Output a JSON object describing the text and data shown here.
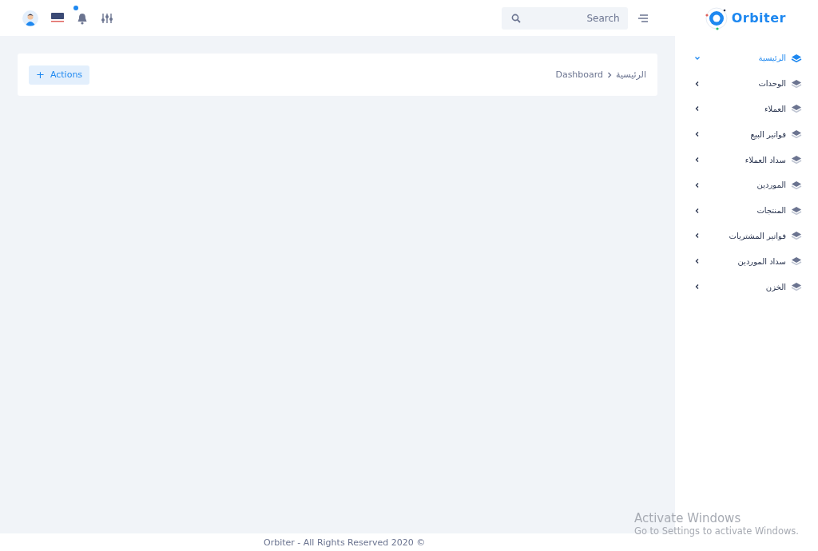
{
  "header": {
    "search": {
      "placeholder": "Search"
    },
    "logo": {
      "text": "Orbiter"
    },
    "notification_dot": true
  },
  "breadcrumb": {
    "items": [
      "الرئيسية",
      "Dashboard"
    ]
  },
  "actions_button": {
    "icon": "+",
    "label": "Actions"
  },
  "sidebar": {
    "items": [
      {
        "label": "الرئيسية",
        "selected": true,
        "expanded": true
      },
      {
        "label": "الوحدات",
        "selected": false,
        "expanded": false
      },
      {
        "label": "العملاء",
        "selected": false,
        "expanded": false
      },
      {
        "label": "فواتير البيع",
        "selected": false,
        "expanded": false
      },
      {
        "label": "سداد العملاء",
        "selected": false,
        "expanded": false
      },
      {
        "label": "الموردين",
        "selected": false,
        "expanded": false
      },
      {
        "label": "المنتجات",
        "selected": false,
        "expanded": false
      },
      {
        "label": "فواتير المشتريات",
        "selected": false,
        "expanded": false
      },
      {
        "label": "سداد الموردين",
        "selected": false,
        "expanded": false
      },
      {
        "label": "الخزن",
        "selected": false,
        "expanded": false
      }
    ]
  },
  "footer": {
    "text": "Orbiter - All Rights Reserved 2020 ©"
  },
  "os_notice": {
    "title": "Activate Windows",
    "text": "Go to Settings to activate Windows."
  }
}
